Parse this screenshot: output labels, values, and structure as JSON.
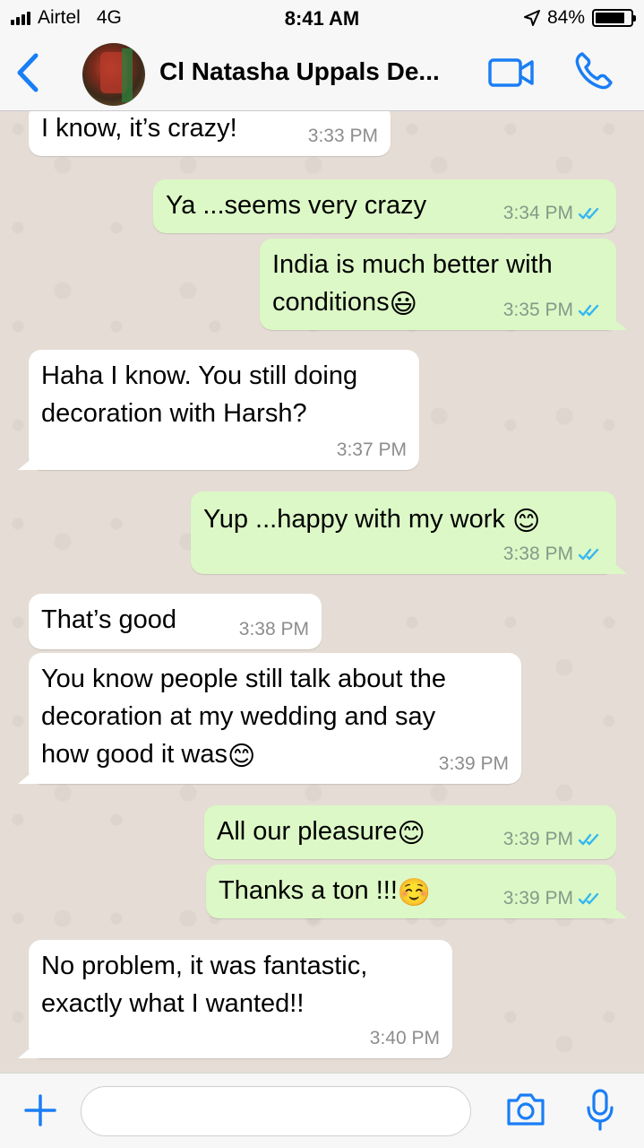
{
  "status_bar": {
    "carrier": "Airtel",
    "network": "4G",
    "time": "8:41 AM",
    "battery": "84%",
    "battery_level": 0.84
  },
  "header": {
    "contact_name": "Cl Natasha Uppals De...",
    "icons": {
      "back": "chevron-left-icon",
      "video": "video-camera-icon",
      "call": "phone-icon"
    }
  },
  "messages": [
    {
      "dir": "in",
      "text": "I know, it’s crazy!",
      "time": "3:33 PM"
    },
    {
      "dir": "out",
      "text": "Ya ...seems very crazy",
      "time": "3:34 PM"
    },
    {
      "dir": "out",
      "text_line1": "India is much better with",
      "text_line2": "conditions",
      "emoji": "😃",
      "time": "3:35 PM"
    },
    {
      "dir": "in",
      "text_line1": "Haha I know. You still doing",
      "text_line2": "decoration with Harsh?",
      "time": "3:37 PM"
    },
    {
      "dir": "out",
      "text": "Yup ...happy with my work ",
      "emoji": "😊",
      "time": "3:38 PM"
    },
    {
      "dir": "in",
      "text": "That’s good",
      "time": "3:38 PM"
    },
    {
      "dir": "in",
      "text_line1": "You know people still talk about the",
      "text_line2": "decoration at my wedding and say",
      "text_line3": "how good it was",
      "emoji": "😊",
      "time": "3:39 PM"
    },
    {
      "dir": "out",
      "text": "All our pleasure",
      "emoji": "😊",
      "time": "3:39 PM"
    },
    {
      "dir": "out",
      "text": "Thanks a ton !!!",
      "emoji": "☺️",
      "time": "3:39 PM"
    },
    {
      "dir": "in",
      "text_line1": "No problem, it was fantastic,",
      "text_line2": "exactly what I wanted!!",
      "time": "3:40 PM"
    }
  ],
  "input_bar": {
    "placeholder": "",
    "icons": {
      "plus": "plus-icon",
      "camera": "camera-icon",
      "mic": "microphone-icon"
    }
  },
  "colors": {
    "accent": "#1a7ef5",
    "outgoing_bubble": "#dcf8c6",
    "incoming_bubble": "#ffffff",
    "chat_background": "#e5ddd5",
    "read_ticks": "#34b7f1"
  }
}
